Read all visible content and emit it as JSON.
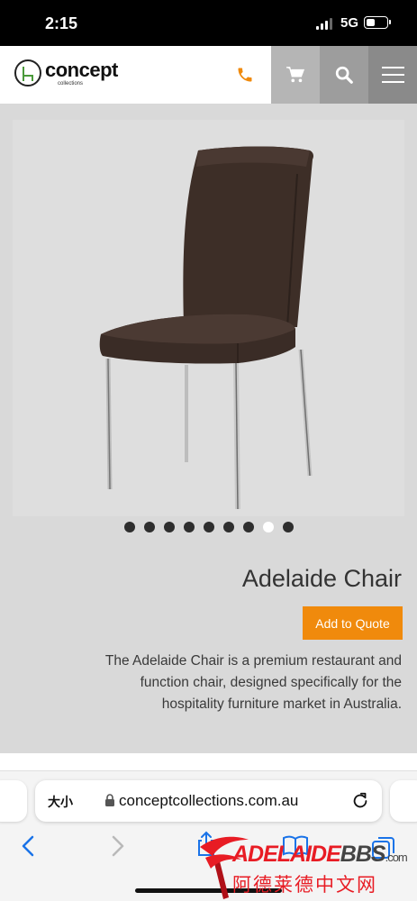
{
  "status_bar": {
    "time": "2:15",
    "network": "5G"
  },
  "header": {
    "logo_text": "concept",
    "logo_subtext": "collections"
  },
  "product": {
    "title": "Adelaide Chair",
    "quote_button": "Add to Quote",
    "description": "The Adelaide Chair is a premium restaurant and function chair, designed specifically for the hospitality furniture market in Australia.",
    "carousel": {
      "slide_count": 9,
      "active_slide": 8
    }
  },
  "browser": {
    "text_size_label": "大小",
    "url": "conceptcollections.com.au"
  },
  "watermark": {
    "brand_red": "ADELAIDE",
    "brand_dark": "BBS",
    "brand_domain": ".com",
    "chinese": "阿德莱德中文网"
  },
  "colors": {
    "accent": "#f08a0c",
    "watermark": "#e81c24"
  }
}
